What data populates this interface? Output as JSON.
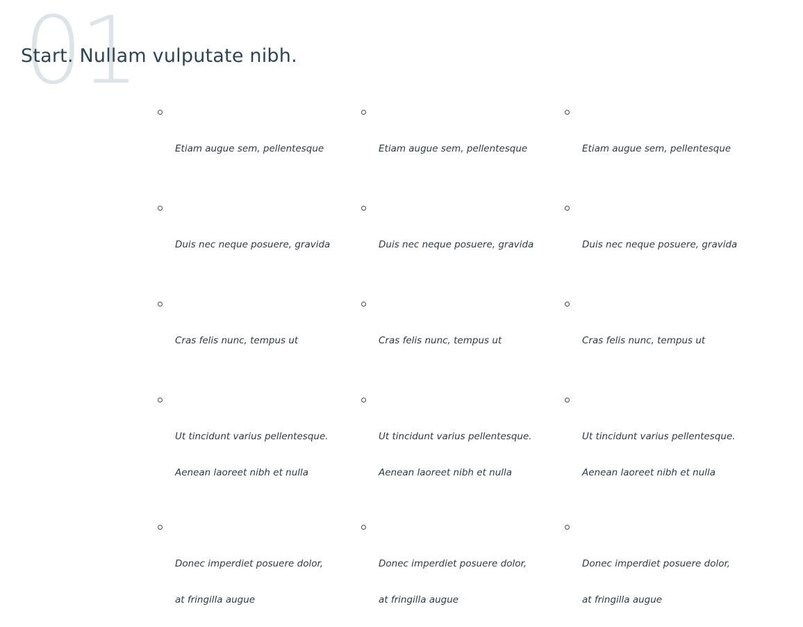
{
  "section": {
    "number": "01",
    "title": "Start. Nullam vulputate nibh."
  },
  "columns": [
    {
      "items": [
        {
          "line1": "Etiam augue sem, pellentesque",
          "line2": ""
        },
        {
          "line1": "Duis nec neque posuere, gravida",
          "line2": ""
        },
        {
          "line1": "Cras felis nunc, tempus ut",
          "line2": ""
        },
        {
          "line1": "Ut tincidunt varius pellentesque.",
          "line2": "Aenean laoreet nibh et nulla"
        },
        {
          "line1": " Donec imperdiet posuere dolor,",
          "line2": "at fringilla augue"
        }
      ]
    },
    {
      "items": [
        {
          "line1": "Etiam augue sem, pellentesque",
          "line2": ""
        },
        {
          "line1": "Duis nec neque posuere, gravida",
          "line2": ""
        },
        {
          "line1": "Cras felis nunc, tempus ut",
          "line2": ""
        },
        {
          "line1": "Ut tincidunt varius pellentesque.",
          "line2": "Aenean laoreet nibh et nulla"
        },
        {
          "line1": " Donec imperdiet posuere dolor,",
          "line2": "at fringilla augue"
        }
      ]
    },
    {
      "items": [
        {
          "line1": "Etiam augue sem, pellentesque",
          "line2": ""
        },
        {
          "line1": "Duis nec neque posuere, gravida",
          "line2": ""
        },
        {
          "line1": "Cras felis nunc, tempus ut",
          "line2": ""
        },
        {
          "line1": "Ut tincidunt varius pellentesque.",
          "line2": "Aenean laoreet nibh et nulla"
        },
        {
          "line1": " Donec imperdiet posuere dolor,",
          "line2": "at fringilla augue"
        }
      ]
    }
  ],
  "colors": {
    "title": "#2d4453",
    "number": "#dde4e7",
    "text": "#2d3a44",
    "bullet": "#3a4b57"
  }
}
